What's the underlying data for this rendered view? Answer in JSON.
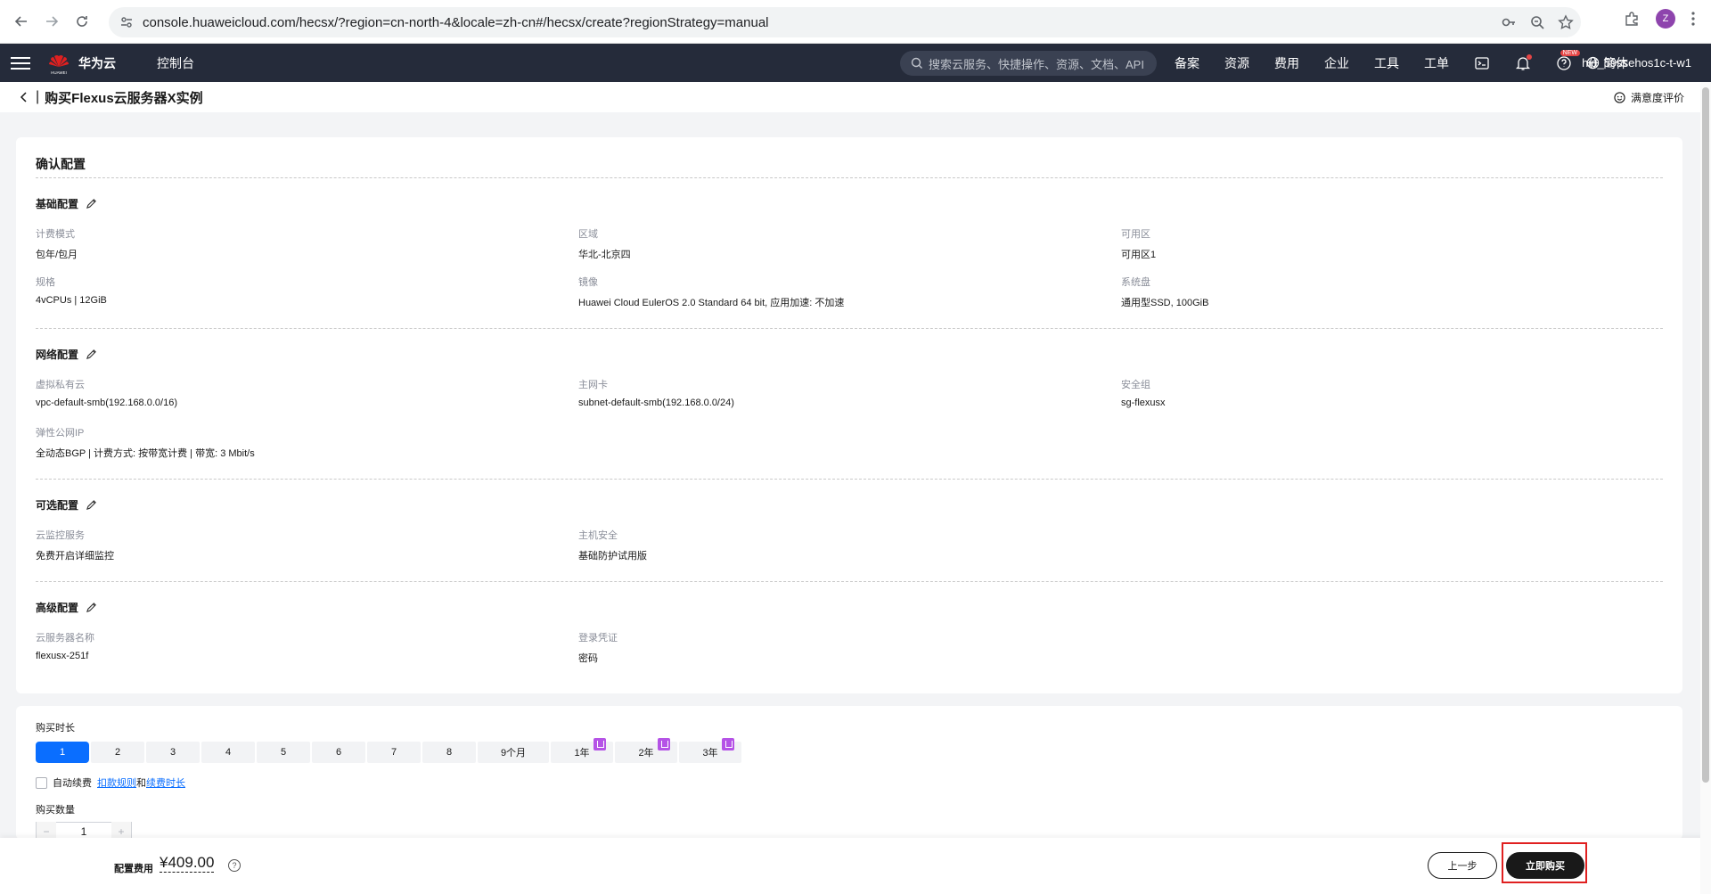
{
  "browser": {
    "url": "console.huaweicloud.com/hecsx/?region=cn-north-4&locale=zh-cn#/hecsx/create?regionStrategy=manual",
    "avatar_letter": "Z"
  },
  "header": {
    "logo_text": "华为云",
    "logo_sub": "HUAWEI",
    "console": "控制台",
    "search_placeholder": "搜索云服务、快捷操作、资源、文档、API",
    "menu": [
      "备案",
      "资源",
      "费用",
      "企业",
      "工具",
      "工单"
    ],
    "new_badge": "NEW",
    "lang": "简体",
    "user": "hid_59ssehos1c-t-w1"
  },
  "page": {
    "title": "购买Flexus云服务器X实例",
    "feedback": "满意度评价"
  },
  "confirm": {
    "title": "确认配置",
    "basic": {
      "title": "基础配置",
      "items": [
        {
          "label": "计费模式",
          "value": "包年/包月"
        },
        {
          "label": "区域",
          "value": "华北-北京四"
        },
        {
          "label": "可用区",
          "value": "可用区1"
        },
        {
          "label": "规格",
          "value": "4vCPUs | 12GiB"
        },
        {
          "label": "镜像",
          "value": "Huawei Cloud EulerOS 2.0 Standard 64 bit, 应用加速: 不加速"
        },
        {
          "label": "系统盘",
          "value": "通用型SSD, 100GiB"
        }
      ]
    },
    "network": {
      "title": "网络配置",
      "items": [
        {
          "label": "虚拟私有云",
          "value": "vpc-default-smb(192.168.0.0/16)"
        },
        {
          "label": "主网卡",
          "value": "subnet-default-smb(192.168.0.0/24)"
        },
        {
          "label": "安全组",
          "value": "sg-flexusx"
        },
        {
          "label": "弹性公网IP",
          "value": "全动态BGP | 计费方式: 按带宽计费 | 带宽: 3 Mbit/s"
        }
      ]
    },
    "optional": {
      "title": "可选配置",
      "items": [
        {
          "label": "云监控服务",
          "value": "免费开启详细监控"
        },
        {
          "label": "主机安全",
          "value": "基础防护试用版"
        }
      ]
    },
    "advanced": {
      "title": "高级配置",
      "items": [
        {
          "label": "云服务器名称",
          "value": "flexusx-251f"
        },
        {
          "label": "登录凭证",
          "value": "密码"
        }
      ]
    }
  },
  "purchase": {
    "duration_label": "购买时长",
    "durations": [
      "1",
      "2",
      "3",
      "4",
      "5",
      "6",
      "7",
      "8",
      "9个月",
      "1年",
      "2年",
      "3年"
    ],
    "selected_duration": "1",
    "auto_renew": "自动续费",
    "renew_rule_link": "扣款规则",
    "renew_and": "和",
    "renew_period_link": "续费时长",
    "quantity_label": "购买数量",
    "quantity": "1",
    "minus": "−",
    "plus": "+"
  },
  "footer": {
    "fee_label": "配置费用",
    "fee_value": "¥409.00",
    "help": "?",
    "prev_button": "上一步",
    "buy_button": "立即购买"
  }
}
